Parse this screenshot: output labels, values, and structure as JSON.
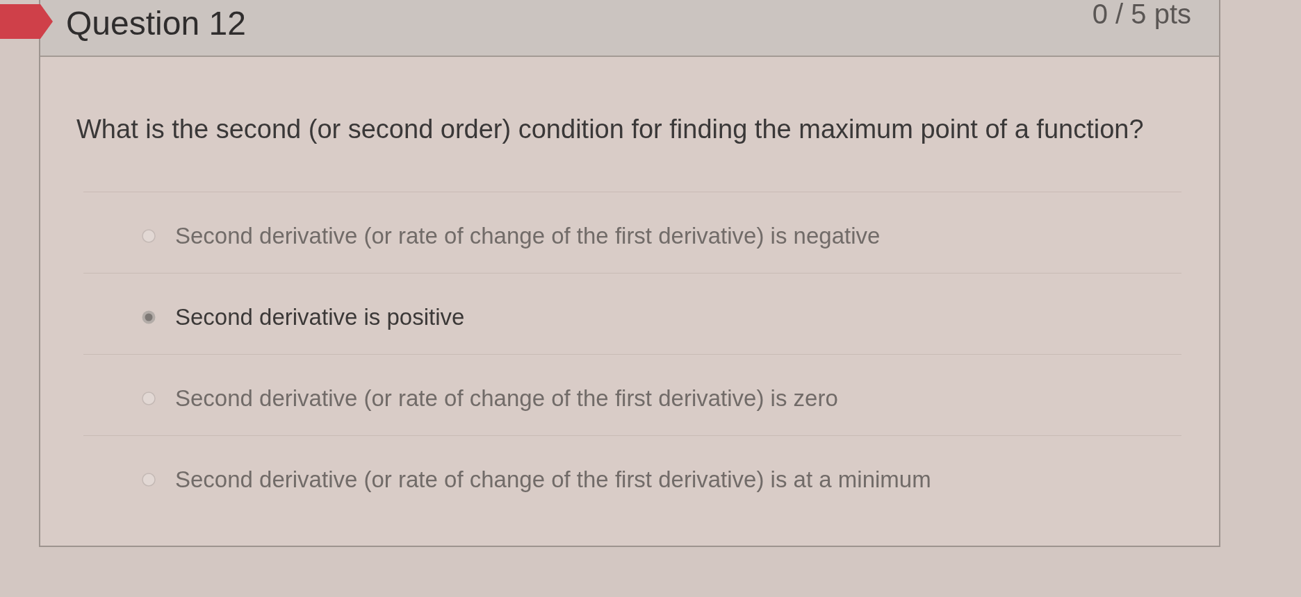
{
  "question": {
    "title": "Question 12",
    "points": "0 / 5 pts",
    "prompt": "What is the second (or second order) condition for finding the maximum point of a function?",
    "answers": [
      {
        "label": "Second derivative (or rate of change of the first derivative) is negative",
        "selected": false
      },
      {
        "label": "Second derivative is positive",
        "selected": true
      },
      {
        "label": "Second derivative (or rate of change of the first derivative) is zero",
        "selected": false
      },
      {
        "label": "Second derivative (or rate of change of the first derivative) is at a minimum",
        "selected": false
      }
    ]
  }
}
